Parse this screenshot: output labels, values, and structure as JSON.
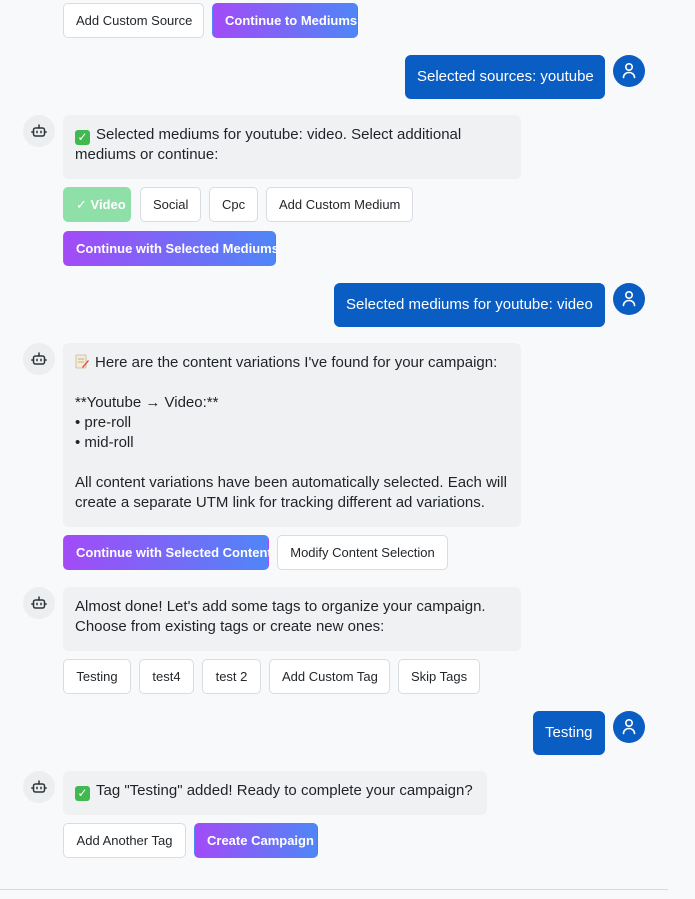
{
  "colors": {
    "user_bubble": "#0a5dc2",
    "gradient_start": "#a24bf7",
    "gradient_end": "#4f86f7",
    "selected_green": "#8fdfa8",
    "bot_bubble": "#f0f1f3",
    "check_green": "#3fb950"
  },
  "top_actions": {
    "add_custom_source": "Add Custom Source",
    "continue_to_mediums": "Continue to Mediums"
  },
  "user_msg_1": {
    "text": "Selected sources: youtube",
    "avatar_icon": "user-icon"
  },
  "bot_msg_1": {
    "avatar_icon": "robot-icon",
    "icon": "check-emoji",
    "lines": [
      "Selected mediums for youtube: video. Select additional",
      "mediums or continue:"
    ],
    "options": [
      "✓ Video",
      "Social",
      "Cpc",
      "Add Custom Medium"
    ],
    "continue": "Continue with Selected Mediums"
  },
  "user_msg_2": {
    "text": "Selected mediums for youtube: video",
    "avatar_icon": "user-icon"
  },
  "bot_msg_2": {
    "avatar_icon": "robot-icon",
    "icon": "memo-emoji",
    "lines": [
      "Here are the content variations I've found for your campaign:",
      "",
      "**Youtube → Video:**",
      "• pre-roll",
      "• mid-roll",
      "",
      "All content variations have been automatically selected. Each will",
      "create a separate UTM link for tracking different ad variations."
    ],
    "continue": "Continue with Selected Content",
    "modify": "Modify Content Selection"
  },
  "bot_msg_3": {
    "avatar_icon": "robot-icon",
    "lines": [
      "Almost done! Let's add some tags to organize your campaign.",
      "Choose from existing tags or create new ones:"
    ],
    "tags": [
      "Testing",
      "test4",
      "test 2",
      "Add Custom Tag",
      "Skip Tags"
    ]
  },
  "user_msg_3": {
    "text": "Testing",
    "avatar_icon": "user-icon"
  },
  "bot_msg_4": {
    "avatar_icon": "robot-icon",
    "icon": "check-emoji",
    "text": "Tag \"Testing\" added! Ready to complete your campaign?",
    "add_another": "Add Another Tag",
    "create": "Create Campaign"
  }
}
